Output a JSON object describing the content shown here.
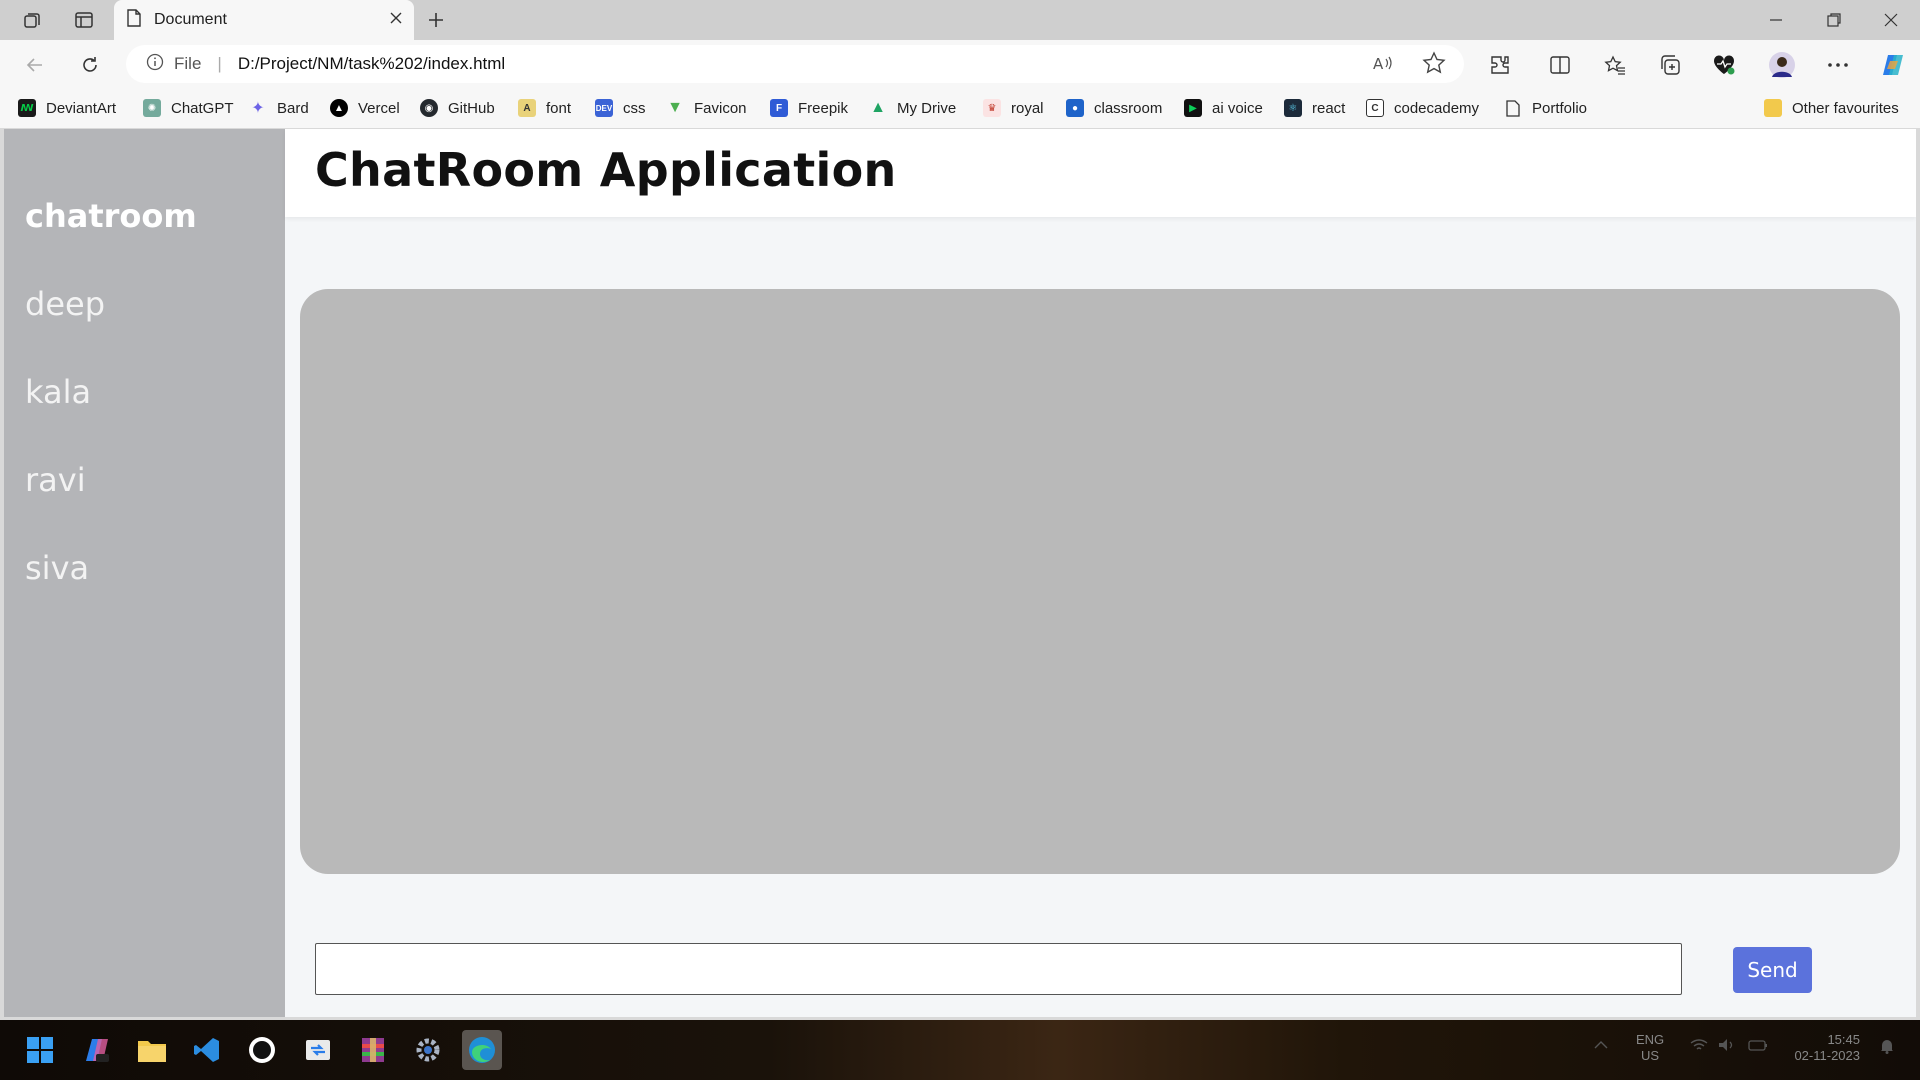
{
  "browser": {
    "tab_title": "Document",
    "address": {
      "scheme": "File",
      "url": "D:/Project/NM/task%202/index.html"
    }
  },
  "bookmarks": [
    {
      "label": "DeviantArt",
      "color": "#05cc47"
    },
    {
      "label": "ChatGPT",
      "color": "#74aa9c"
    },
    {
      "label": "Bard",
      "color": "#4285f4"
    },
    {
      "label": "Vercel",
      "color": "#000000"
    },
    {
      "label": "GitHub",
      "color": "#24292e"
    },
    {
      "label": "font",
      "color": "#8a6d1a"
    },
    {
      "label": "css",
      "color": "#3b63d6"
    },
    {
      "label": "Favicon",
      "color": "#4caf50"
    },
    {
      "label": "Freepik",
      "color": "#2f5bd6"
    },
    {
      "label": "My Drive",
      "color": "#1fa463"
    },
    {
      "label": "royal",
      "color": "#c0392b"
    },
    {
      "label": "classroom",
      "color": "#1e63c9"
    },
    {
      "label": "ai voice",
      "color": "#0a8a3a"
    },
    {
      "label": "react",
      "color": "#1c2a3a"
    },
    {
      "label": "codecademy",
      "color": "#444444"
    },
    {
      "label": "Portfolio",
      "color": "#777777"
    }
  ],
  "other_favourites": "Other favourites",
  "app": {
    "title": "ChatRoom Application",
    "sidebar": [
      {
        "label": "chatroom",
        "active": true
      },
      {
        "label": "deep"
      },
      {
        "label": "kala"
      },
      {
        "label": "ravi"
      },
      {
        "label": "siva"
      }
    ],
    "message_input": {
      "value": "",
      "placeholder": ""
    },
    "send_label": "Send"
  },
  "tray": {
    "lang_top": "ENG",
    "lang_bottom": "US",
    "time": "15:45",
    "date": "02-11-2023"
  },
  "colors": {
    "sidebar_bg": "#b4b5b8",
    "chatbox_bg": "#b9b9b9",
    "send_button": "#5b72dc"
  }
}
